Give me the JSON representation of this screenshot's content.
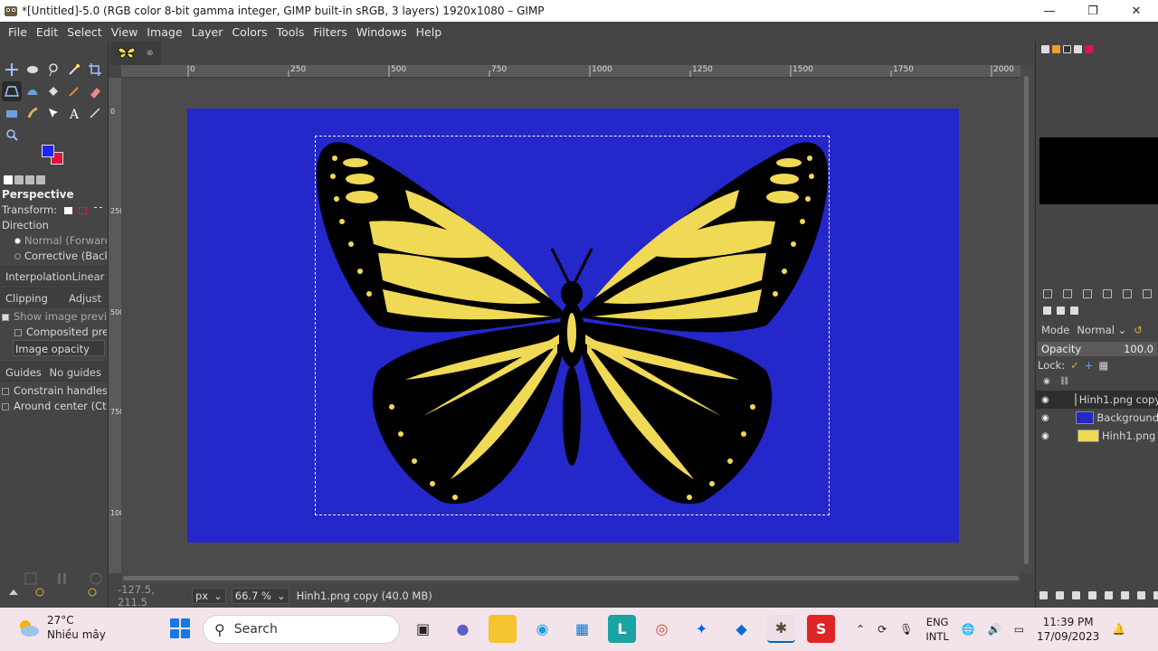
{
  "window": {
    "title": "*[Untitled]-5.0 (RGB color 8-bit gamma integer, GIMP built-in sRGB, 3 layers) 1920x1080 – GIMP",
    "minimize": "—",
    "maximize": "❐",
    "close": "✕"
  },
  "menu": [
    "File",
    "Edit",
    "Select",
    "View",
    "Image",
    "Layer",
    "Colors",
    "Tools",
    "Filters",
    "Windows",
    "Help"
  ],
  "tool_options": {
    "title": "Perspective",
    "transform_label": "Transform:",
    "direction_label": "Direction",
    "direction_normal": "Normal (Forward)",
    "direction_corrective": "Corrective (Backward)",
    "interpolation_label": "Interpolation",
    "interpolation_value": "Linear",
    "clipping_label": "Clipping",
    "clipping_value": "Adjust",
    "show_preview": "Show image preview",
    "composited_preview": "Composited preview",
    "image_opacity": "Image opacity",
    "guides_label": "Guides",
    "guides_value": "No guides",
    "constrain_handles": "Constrain handles (Shift)",
    "around_center": "Around center (Ctrl)"
  },
  "rulers": {
    "top": [
      "0",
      "250",
      "500",
      "750",
      "1000",
      "1250",
      "1500",
      "1750",
      "2000"
    ],
    "left": [
      "0",
      "250",
      "500",
      "750",
      "1000"
    ]
  },
  "status": {
    "coords": "-127.5, 211.5",
    "unit": "px",
    "zoom": "66.7 %",
    "message": "Hinh1.png copy (40.0 MB)"
  },
  "layers_panel": {
    "mode_label": "Mode",
    "mode_value": "Normal",
    "opacity_label": "Opacity",
    "opacity_value": "100.0",
    "lock_label": "Lock:",
    "layers": [
      {
        "name": "Hinh1.png copy",
        "thumb": "butterfly",
        "selected": true
      },
      {
        "name": "Background",
        "thumb": "blue",
        "selected": false
      },
      {
        "name": "Hinh1.png",
        "thumb": "butterfly",
        "selected": false
      }
    ]
  },
  "colors": {
    "foreground": "#2121ff",
    "background": "#e0143c",
    "canvas_fill": "#2427c9",
    "wing_yellow": "#f0d954"
  },
  "taskbar": {
    "temperature": "27°C",
    "weather": "Nhiều mây",
    "search_placeholder": "Search",
    "lang_top": "ENG",
    "lang_bottom": "INTL",
    "time": "11:39 PM",
    "date": "17/09/2023"
  }
}
